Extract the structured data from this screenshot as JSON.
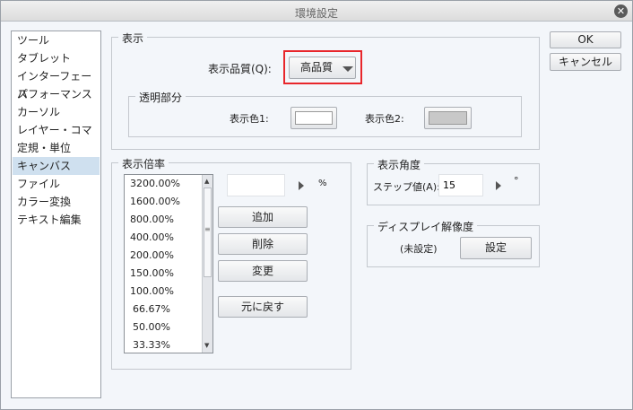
{
  "window": {
    "title": "環境設定"
  },
  "sidebar": {
    "items": [
      {
        "label": "ツール"
      },
      {
        "label": "タブレット"
      },
      {
        "label": "インターフェース"
      },
      {
        "label": "パフォーマンス"
      },
      {
        "label": "カーソル"
      },
      {
        "label": "レイヤー・コマ"
      },
      {
        "label": "定規・単位"
      },
      {
        "label": "キャンバス",
        "selected": true
      },
      {
        "label": "ファイル"
      },
      {
        "label": "カラー変換"
      },
      {
        "label": "テキスト編集"
      }
    ]
  },
  "display": {
    "label": "表示",
    "quality_label": "表示品質(Q):",
    "quality_value": "高品質",
    "transparent": {
      "label": "透明部分",
      "color1_label": "表示色1:",
      "color1": "#ffffff",
      "color2_label": "表示色2:",
      "color2": "#c8c8c8"
    },
    "highlight_color": "#e8262b"
  },
  "zoom": {
    "label": "表示倍率",
    "values": [
      "3200.00%",
      "1600.00%",
      "800.00%",
      "400.00%",
      "200.00%",
      "150.00%",
      "100.00%",
      "66.67%",
      "50.00%",
      "33.33%"
    ],
    "input_value": "",
    "unit": "%",
    "add": "追加",
    "delete": "削除",
    "change": "変更",
    "reset": "元に戻す"
  },
  "angle": {
    "label": "表示角度",
    "step_label": "ステップ値(A):",
    "step_value": "15",
    "unit": "°"
  },
  "resolution": {
    "label": "ディスプレイ解像度",
    "status": "(未設定)",
    "set_button": "設定"
  },
  "buttons": {
    "ok": "OK",
    "cancel": "キャンセル"
  }
}
